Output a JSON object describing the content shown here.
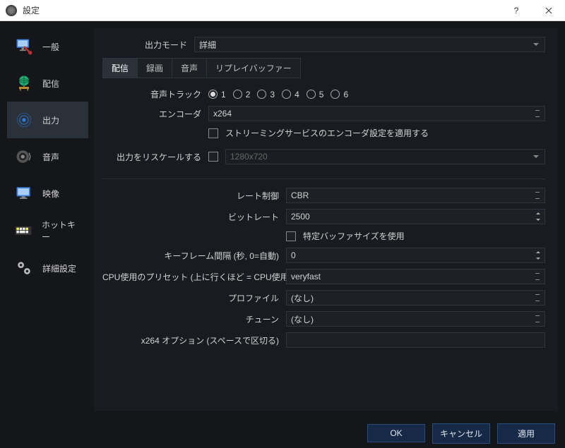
{
  "window": {
    "title": "設定"
  },
  "sidebar": {
    "items": [
      {
        "label": "一般"
      },
      {
        "label": "配信"
      },
      {
        "label": "出力"
      },
      {
        "label": "音声"
      },
      {
        "label": "映像"
      },
      {
        "label": "ホットキー"
      },
      {
        "label": "詳細設定"
      }
    ]
  },
  "output_mode": {
    "label": "出力モード",
    "value": "詳細"
  },
  "tabs": [
    "配信",
    "録画",
    "音声",
    "リプレイバッファー"
  ],
  "audio_track": {
    "label": "音声トラック",
    "options": [
      "1",
      "2",
      "3",
      "4",
      "5",
      "6"
    ],
    "selected": "1"
  },
  "encoder": {
    "label": "エンコーダ",
    "value": "x264"
  },
  "apply_service": {
    "label": "ストリーミングサービスのエンコーダ設定を適用する"
  },
  "rescale": {
    "label": "出力をリスケールする",
    "value": "1280x720"
  },
  "rate_control": {
    "label": "レート制御",
    "value": "CBR"
  },
  "bitrate": {
    "label": "ビットレート",
    "value": "2500"
  },
  "custom_buffer": {
    "label": "特定バッファサイズを使用"
  },
  "keyframe": {
    "label": "キーフレーム間隔 (秒, 0=自動)",
    "value": "0"
  },
  "cpu_preset": {
    "label": "CPU使用のプリセット (上に行くほど = CPU使用低い)",
    "value": "veryfast"
  },
  "profile": {
    "label": "プロファイル",
    "value": "(なし)"
  },
  "tune": {
    "label": "チューン",
    "value": "(なし)"
  },
  "x264opts": {
    "label": "x264 オプション (スペースで区切る)",
    "value": ""
  },
  "footer": {
    "ok": "OK",
    "cancel": "キャンセル",
    "apply": "適用"
  }
}
